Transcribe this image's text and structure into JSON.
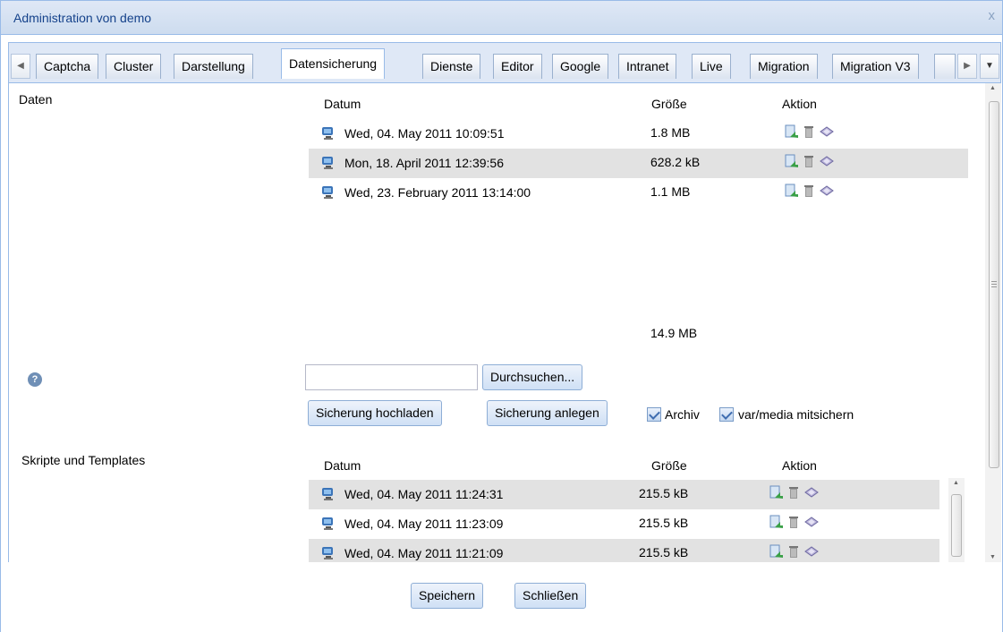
{
  "window": {
    "title": "Administration von demo",
    "close_glyph": "x"
  },
  "tabs": [
    "Captcha",
    "Cluster",
    "Darstellung",
    "Datensicherung",
    "Dienste",
    "Editor",
    "Google",
    "Intranet",
    "Live",
    "Migration",
    "Migration V3"
  ],
  "active_tab": "Datensicherung",
  "daten": {
    "label": "Daten",
    "columns": {
      "date": "Datum",
      "size": "Größe",
      "action": "Aktion"
    },
    "rows": [
      {
        "date": "Wed, 04. May 2011 10:09:51",
        "size": "1.8 MB"
      },
      {
        "date": "Mon, 18. April 2011 12:39:56",
        "size": "628.2 kB"
      },
      {
        "date": "Wed, 23. February 2011 13:14:00",
        "size": "1.1 MB"
      }
    ],
    "total": "14.9 MB"
  },
  "upload": {
    "browse_button": "Durchsuchen...",
    "upload_button": "Sicherung hochladen",
    "create_button": "Sicherung anlegen",
    "archive_label": "Archiv",
    "media_label": "var/media mitsichern",
    "archive_checked": true,
    "media_checked": true
  },
  "skripte": {
    "label": "Skripte und Templates",
    "columns": {
      "date": "Datum",
      "size": "Größe",
      "action": "Aktion"
    },
    "rows": [
      {
        "date": "Wed, 04. May 2011 11:24:31",
        "size": "215.5 kB"
      },
      {
        "date": "Wed, 04. May 2011 11:23:09",
        "size": "215.5 kB"
      },
      {
        "date": "Wed, 04. May 2011 11:21:09",
        "size": "215.5 kB"
      }
    ]
  },
  "footer": {
    "save": "Speichern",
    "close": "Schließen"
  },
  "icons": {
    "row_icon": "computer-icon",
    "action_icons": [
      "restore-icon",
      "trash-icon",
      "install-icon"
    ],
    "help": "help-icon"
  },
  "colors": {
    "accent": "#99bbe8",
    "title_text": "#15428b",
    "alt_row": "#e2e2e2"
  }
}
